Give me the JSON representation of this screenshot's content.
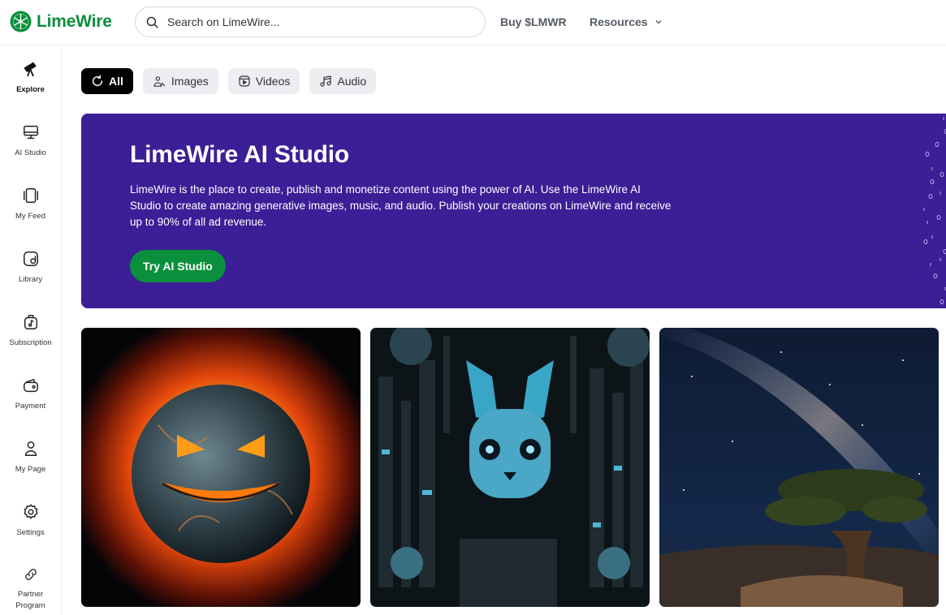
{
  "brand": {
    "name": "LimeWire",
    "color": "#0a8f3c"
  },
  "header": {
    "search_placeholder": "Search on LimeWire...",
    "links": [
      {
        "label": "Buy $LMWR"
      },
      {
        "label": "Resources"
      }
    ]
  },
  "sidebar": {
    "items": [
      {
        "label": "Explore",
        "icon": "telescope-icon"
      },
      {
        "label": "AI Studio",
        "icon": "monitor-icon"
      },
      {
        "label": "My Feed",
        "icon": "feed-icon"
      },
      {
        "label": "Library",
        "icon": "library-icon"
      },
      {
        "label": "Subscription",
        "icon": "music-bag-icon"
      },
      {
        "label": "Payment",
        "icon": "wallet-icon"
      },
      {
        "label": "My Page",
        "icon": "user-icon"
      },
      {
        "label": "Settings",
        "icon": "gear-icon"
      },
      {
        "label": "Partner Program",
        "icon": "link-icon"
      }
    ]
  },
  "filters": [
    {
      "label": "All",
      "icon": "refresh-icon"
    },
    {
      "label": "Images",
      "icon": "image-icon"
    },
    {
      "label": "Videos",
      "icon": "video-icon"
    },
    {
      "label": "Audio",
      "icon": "music-note-icon"
    }
  ],
  "banner": {
    "title": "LimeWire AI Studio",
    "description": "LimeWire is the place to create, publish and monetize content using the power of AI. Use the LimeWire AI Studio to create amazing generative images, music, and audio. Publish your creations on LimeWire and receive up to 90% of all ad revenue.",
    "cta_label": "Try AI Studio",
    "bg_color": "#3c1e96"
  },
  "gallery": [
    {
      "subject": "fiery evil planet"
    },
    {
      "subject": "cyber robot rabbit"
    },
    {
      "subject": "milky way over tree"
    }
  ]
}
